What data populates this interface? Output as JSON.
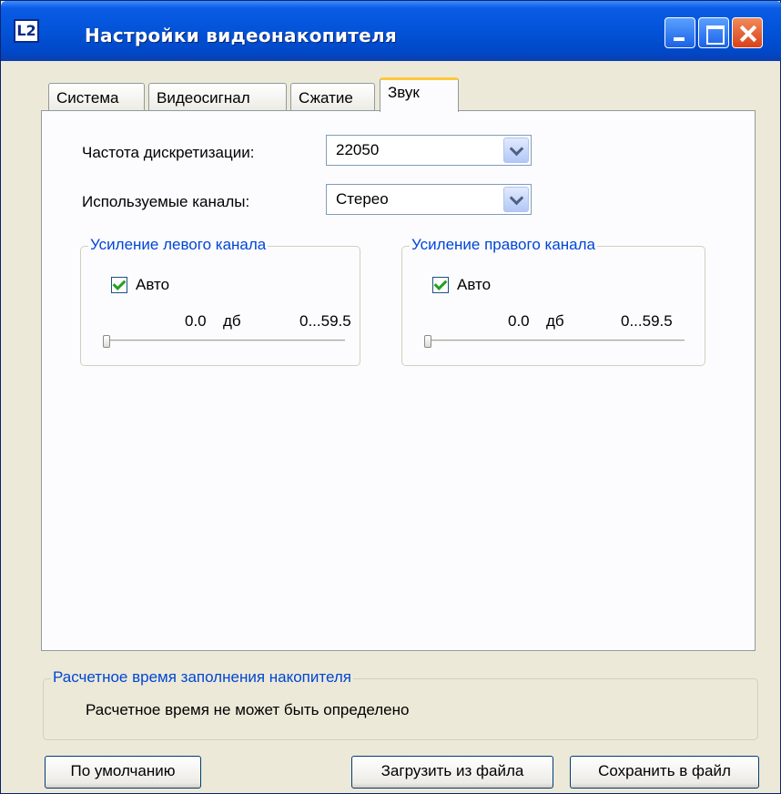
{
  "window": {
    "title": "Настройки видеонакопителя",
    "icon_text": "L2",
    "controls": [
      "minimize-icon",
      "maximize-icon",
      "close-icon"
    ]
  },
  "tabs": [
    {
      "label": "Система",
      "active": false
    },
    {
      "label": "Видеосигнал",
      "active": false
    },
    {
      "label": "Сжатие",
      "active": false
    },
    {
      "label": "Звук",
      "active": true
    }
  ],
  "sound": {
    "sample_rate": {
      "label": "Частота дискретизации:",
      "value": "22050"
    },
    "channels": {
      "label": "Используемые каналы:",
      "value": "Стерео"
    },
    "left_gain": {
      "title": "Усиление левого канала",
      "auto_label": "Авто",
      "auto_checked": true,
      "value_text": "0.0",
      "unit": "дб",
      "range_text": "0...59.5",
      "slider_value": 0.0,
      "slider_max": 59.5
    },
    "right_gain": {
      "title": "Усиление правого канала",
      "auto_label": "Авто",
      "auto_checked": true,
      "value_text": "0.0",
      "unit": "дб",
      "range_text": "0...59.5",
      "slider_value": 0.0,
      "slider_max": 59.5
    }
  },
  "estimate": {
    "title": "Расчетное время заполнения накопителя",
    "text": "Расчетное время не может быть определено"
  },
  "buttons": {
    "defaults": "По умолчанию",
    "load": "Загрузить из файла",
    "save": "Сохранить в файл"
  },
  "colors": {
    "titlebar": "#0353d8",
    "group_title": "#0046d5",
    "active_tab_accent": "#ffc83c",
    "checkmark": "#21a121"
  }
}
